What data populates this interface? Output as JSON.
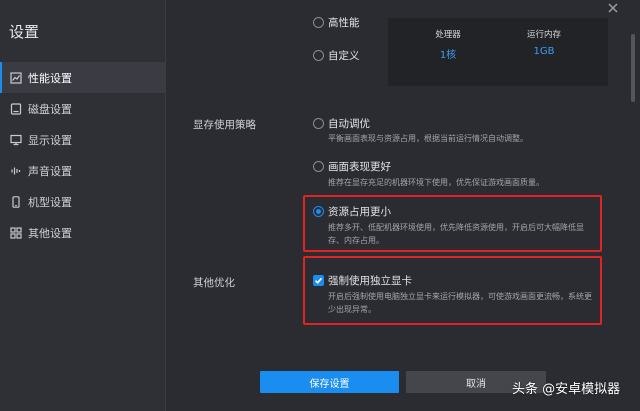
{
  "window": {
    "title": "设置",
    "close_icon": "close-icon"
  },
  "sidebar": {
    "items": [
      {
        "label": "性能设置",
        "icon": "performance-chart-icon",
        "active": true
      },
      {
        "label": "磁盘设置",
        "icon": "disk-icon",
        "active": false
      },
      {
        "label": "显示设置",
        "icon": "monitor-icon",
        "active": false
      },
      {
        "label": "声音设置",
        "icon": "sound-wave-icon",
        "active": false
      },
      {
        "label": "机型设置",
        "icon": "phone-icon",
        "active": false
      },
      {
        "label": "其他设置",
        "icon": "grid-icon",
        "active": false
      }
    ]
  },
  "performance": {
    "options": [
      {
        "label": "高性能",
        "checked": false
      },
      {
        "label": "自定义",
        "checked": false
      }
    ],
    "spec": {
      "cpu_label": "处理器",
      "cpu_value": "1核",
      "ram_label": "运行内存",
      "ram_value": "1GB"
    }
  },
  "memory_strategy": {
    "label": "显存使用策略",
    "options": [
      {
        "label": "自动调优",
        "desc": "平衡画面表现与资源占用，根据当前运行情况自动调整。",
        "checked": false
      },
      {
        "label": "画面表现更好",
        "desc": "推荐在显存充足的机器环境下使用，优先保证游戏画面质量。",
        "checked": false
      },
      {
        "label": "资源占用更小",
        "desc": "推荐多开、低配机器环境使用，优先降低资源使用，开启后可大幅降低显存、内存占用。",
        "checked": true
      }
    ]
  },
  "other": {
    "label": "其他优化",
    "checkbox_label": "强制使用独立显卡",
    "checkbox_desc": "开启后强制使用电脑独立显卡来运行模拟器，可使游戏画面更流畅，系统更少出现异常。",
    "checked": true
  },
  "buttons": {
    "save": "保存设置",
    "cancel": "取消"
  },
  "watermark": "头条 @安卓模拟器",
  "colors": {
    "accent": "#1a8df0",
    "highlight": "#e02424",
    "background": "#2b2c31"
  }
}
